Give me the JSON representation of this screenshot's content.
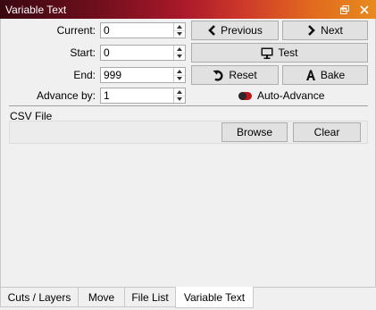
{
  "window": {
    "title": "Variable Text",
    "float_icon": "float-window-icon",
    "close_icon": "close-icon"
  },
  "fields": {
    "current": {
      "label": "Current:",
      "value": "0"
    },
    "start": {
      "label": "Start:",
      "value": "0"
    },
    "end": {
      "label": "End:",
      "value": "999"
    },
    "advance_by": {
      "label": "Advance by:",
      "value": "1"
    }
  },
  "buttons": {
    "previous": {
      "label": "Previous",
      "icon": "chevron-left-icon"
    },
    "next": {
      "label": "Next",
      "icon": "chevron-right-icon"
    },
    "test": {
      "label": "Test",
      "icon": "monitor-icon"
    },
    "reset": {
      "label": "Reset",
      "icon": "reset-arrow-icon"
    },
    "bake": {
      "label": "Bake",
      "icon": "letter-a-icon"
    },
    "browse": {
      "label": "Browse"
    },
    "clear": {
      "label": "Clear"
    }
  },
  "auto_advance": {
    "label": "Auto-Advance",
    "enabled": false,
    "color": "#c0141e"
  },
  "csv_group": {
    "title": "CSV File"
  },
  "tabs": [
    {
      "label": "Cuts / Layers",
      "active": false
    },
    {
      "label": "Move",
      "active": false
    },
    {
      "label": "File List",
      "active": false
    },
    {
      "label": "Variable Text",
      "active": true
    }
  ]
}
